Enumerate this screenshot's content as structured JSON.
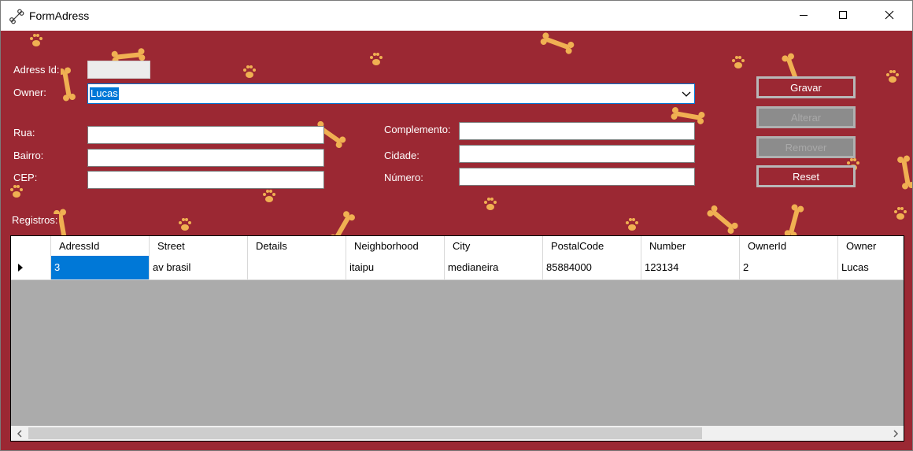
{
  "window": {
    "title": "FormAdress",
    "app_icon": "bone-icon",
    "minimize_icon": "minimize-icon",
    "maximize_icon": "maximize-icon",
    "close_icon": "close-icon",
    "background_color": "#9b2833"
  },
  "form": {
    "adress_id": {
      "label": "Adress Id:",
      "value": ""
    },
    "owner": {
      "label": "Owner:",
      "value": "Lucas"
    },
    "rua": {
      "label": "Rua:",
      "value": ""
    },
    "bairro": {
      "label": "Bairro:",
      "value": ""
    },
    "cep": {
      "label": "CEP:",
      "value": ""
    },
    "complemento": {
      "label": "Complemento:",
      "value": ""
    },
    "cidade": {
      "label": "Cidade:",
      "value": ""
    },
    "numero": {
      "label": "Número:",
      "value": ""
    }
  },
  "buttons": {
    "gravar": "Gravar",
    "alterar": "Alterar",
    "remover": "Remover",
    "reset": "Reset"
  },
  "registros_label": "Registros:",
  "grid": {
    "columns": [
      "AdressId",
      "Street",
      "Details",
      "Neighborhood",
      "City",
      "PostalCode",
      "Number",
      "OwnerId",
      "Owner"
    ],
    "rows": [
      [
        "3",
        "av brasil",
        "",
        "itaipu",
        "medianeira",
        "85884000",
        "123134",
        "2",
        "Lucas"
      ]
    ],
    "selected_cell": "AdressId"
  }
}
